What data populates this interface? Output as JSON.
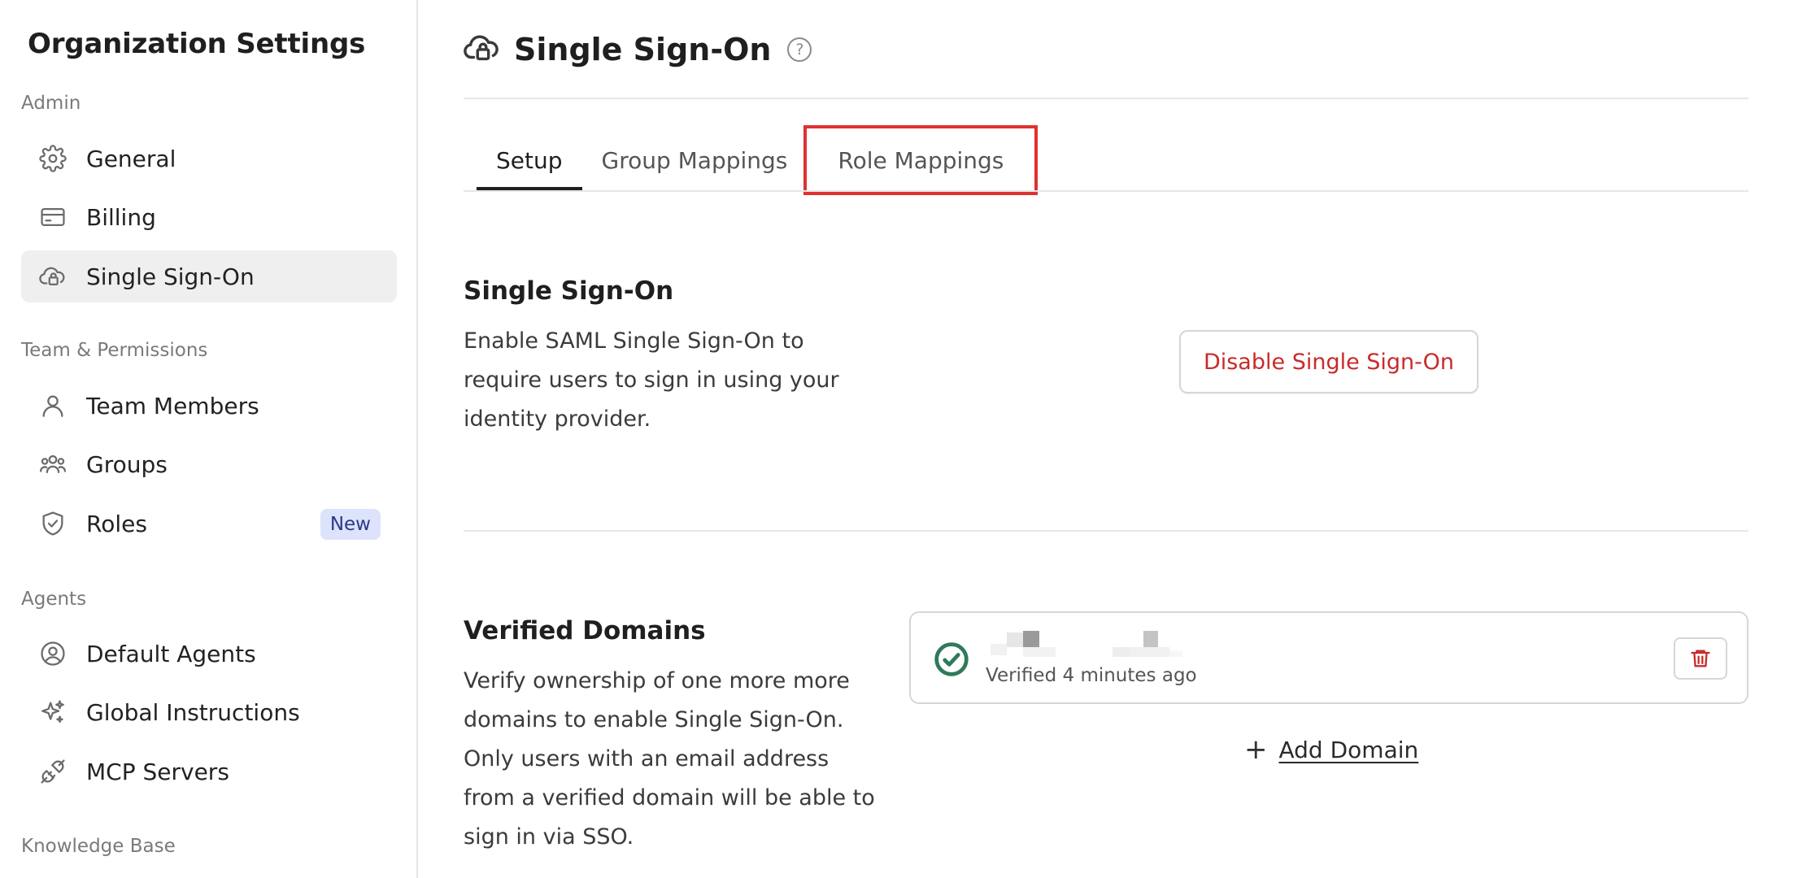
{
  "sidebar": {
    "title": "Organization Settings",
    "sections": [
      {
        "label": "Admin"
      },
      {
        "label": "Team & Permissions"
      },
      {
        "label": "Agents"
      },
      {
        "label": "Knowledge Base"
      }
    ],
    "items": [
      {
        "label": "General",
        "icon": "gear-icon"
      },
      {
        "label": "Billing",
        "icon": "credit-card-icon"
      },
      {
        "label": "Single Sign-On",
        "icon": "cloud-lock-icon",
        "active": true
      },
      {
        "label": "Team Members",
        "icon": "user-icon"
      },
      {
        "label": "Groups",
        "icon": "users-icon"
      },
      {
        "label": "Roles",
        "icon": "shield-check-icon",
        "badge": "New"
      },
      {
        "label": "Default Agents",
        "icon": "user-circle-icon"
      },
      {
        "label": "Global Instructions",
        "icon": "sparkles-icon"
      },
      {
        "label": "MCP Servers",
        "icon": "plug-icon"
      }
    ]
  },
  "header": {
    "title": "Single Sign-On",
    "help_glyph": "?"
  },
  "tabs": [
    {
      "label": "Setup",
      "active": true
    },
    {
      "label": "Group Mappings"
    },
    {
      "label": "Role Mappings",
      "highlighted": true
    }
  ],
  "sso": {
    "title": "Single Sign-On",
    "desc_lines": [
      "Enable SAML Single Sign-On to",
      "require users to sign in using your",
      "identity provider."
    ],
    "disable_label": "Disable Single Sign-On"
  },
  "domains": {
    "title": "Verified Domains",
    "desc_lines": [
      "Verify ownership of one more more",
      "domains to enable Single Sign-On.",
      "Only users with an email address",
      "from a verified domain will be able to",
      "sign in via SSO."
    ],
    "items": [
      {
        "status": "Verified 4 minutes ago"
      }
    ],
    "add_label": "Add Domain"
  },
  "colors": {
    "accent_red": "#c92a2a",
    "highlight_red": "#e03131",
    "verified_green": "#2f7a5a",
    "badge_bg": "#dde3fb"
  }
}
